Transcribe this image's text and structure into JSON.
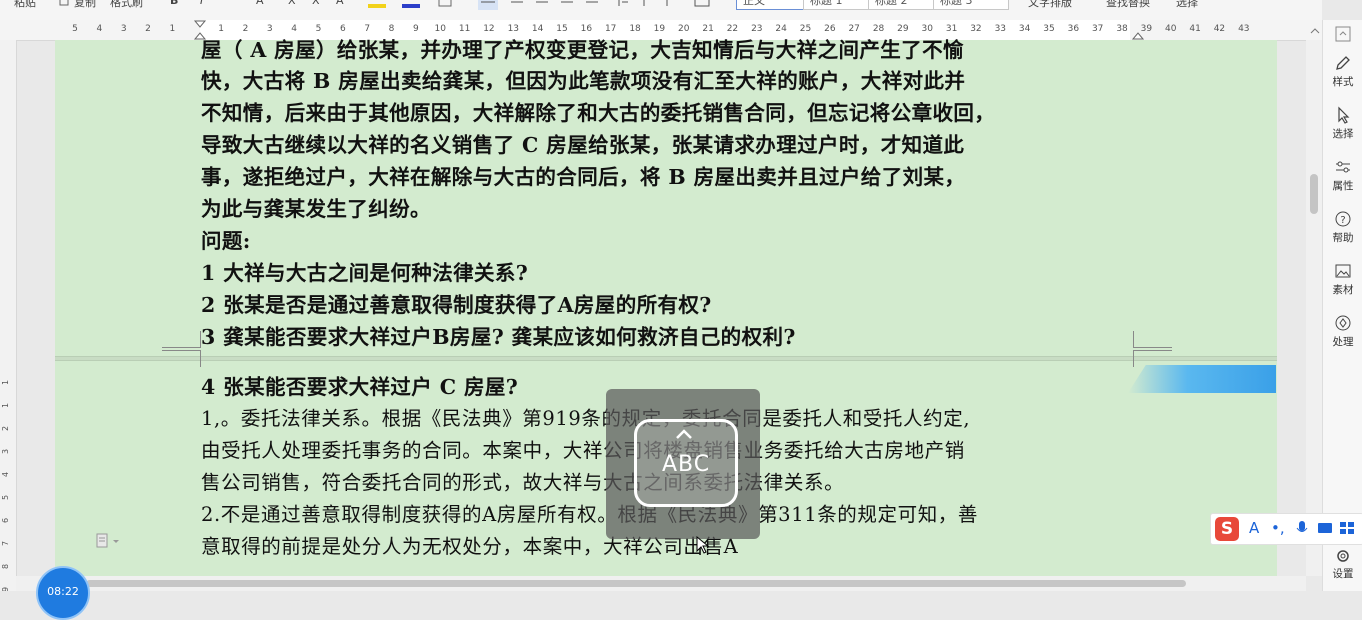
{
  "toolbar": {
    "items": [
      "粘贴",
      "复制",
      "格式刷"
    ],
    "styles": [
      "正文",
      "标题 1",
      "标题 2",
      "标题 3"
    ],
    "right_items": [
      "文字排版",
      "查找替换",
      "选择"
    ]
  },
  "ruler": {
    "h_ticks": [
      "5",
      "4",
      "3",
      "2",
      "1",
      "",
      "1",
      "2",
      "3",
      "4",
      "5",
      "6",
      "7",
      "8",
      "9",
      "10",
      "11",
      "12",
      "13",
      "14",
      "15",
      "16",
      "17",
      "18",
      "19",
      "20",
      "21",
      "22",
      "23",
      "24",
      "25",
      "26",
      "27",
      "28",
      "29",
      "30",
      "31",
      "32",
      "33",
      "34",
      "35",
      "36",
      "37",
      "38",
      "39",
      "40",
      "41",
      "42",
      "43"
    ],
    "v_ticks": [
      "1",
      "1",
      "2",
      "3",
      "4",
      "5",
      "6",
      "7",
      "8",
      "9"
    ]
  },
  "document": {
    "partial_top_line": "屋（ A 房屋）给张某，并办理了产权变更登记，大吉知情后与大祥之间产生了不愉",
    "case_lines": [
      "快，大古将  B  房屋出卖给龚某，但因为此笔款项没有汇至大祥的账户，大祥对此并",
      "不知情，后来由于其他原因，大祥解除了和大古的委托销售合同，但忘记将公章收回，",
      "导致大古继续以大祥的名义销售了  C  房屋给张某，张某请求办理过户时，才知道此",
      "事，遂拒绝过户，大祥在解除与大古的合同后，将  B  房屋出卖并且过户给了刘某，",
      "为此与龚某发生了纠纷。"
    ],
    "questions_heading": "问题:",
    "questions": [
      " 1   大祥与大古之间是何种法律关系?",
      " 2   张某是否是通过善意取得制度获得了A房屋的所有权?",
      " 3   龚某能否要求大祥过户B房屋? 龚某应该如何救济自己的权利?",
      " 4   张某能否要求大祥过户  C  房屋?"
    ],
    "answer_lines": [
      "1,。委托法律关系。根据《民法典》第919条的规定，委托合同是委托人和受托人约定,",
      "由受托人处理委托事务的合同。本案中，大祥公司将楼盘销售业务委托给大古房地产销",
      "售公司销售，符合委托合同的形式，故大祥与大古之间系委托法律关系。",
      "2.不是通过善意取得制度获得的A房屋所有权。根据《民法典》第311条的规定可知，善",
      "意取得的前提是处分人为无权处分，本案中，大祥公司出售A"
    ]
  },
  "overlay": {
    "abc_label": "ABC"
  },
  "sidebar": {
    "items": [
      "样式",
      "选择",
      "属性",
      "帮助",
      "素材",
      "处理",
      "设置"
    ]
  },
  "ime": {
    "logo": "S",
    "letter": "A"
  },
  "clock": {
    "time": "08:22"
  },
  "colors": {
    "page_bg": "#d3ebcf",
    "accent": "#1f7be0"
  }
}
